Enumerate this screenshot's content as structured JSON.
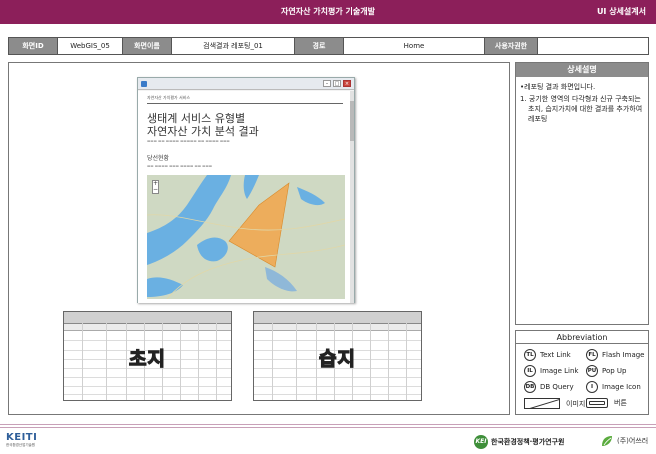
{
  "header": {
    "title": "자연자산 가치평가 기술개발",
    "doc_type": "UI 상세설계서"
  },
  "info": {
    "screen_id_label": "화면ID",
    "screen_id": "WebGIS_05",
    "screen_name_label": "화면이름",
    "screen_name": "검색결과 레포팅_01",
    "path_label": "경로",
    "path": "Home",
    "permission_label": "사용자권한",
    "permission": ""
  },
  "browser": {
    "site_name": "자연자산 가치평가 서비스",
    "heading_line1": "생태계 서비스 유형별",
    "heading_line2": "자연자산 가치 분석 결과",
    "section_title": "당선현황"
  },
  "tables": [
    {
      "overlay": "초지"
    },
    {
      "overlay": "습지"
    }
  ],
  "detail": {
    "header": "상세설명",
    "intro": "•레포팅 결과 화면입니다.",
    "items": [
      "1. 궁기한 영역의 다각형과 신규 구축되는 초지, 습지가치에 대한 결과를 추가하여 레포팅"
    ]
  },
  "abbreviation": {
    "header": "Abbreviation",
    "entries": [
      {
        "code": "TL",
        "label": "Text Link"
      },
      {
        "code": "FL",
        "label": "Flash Image"
      },
      {
        "code": "IL",
        "label": "Image Link"
      },
      {
        "code": "PU",
        "label": "Pop Up"
      },
      {
        "code": "DB",
        "label": "DB Query"
      },
      {
        "code": "I",
        "label": "Image Icon"
      }
    ],
    "image_label": "이미지",
    "button_label": "버튼"
  },
  "footer": {
    "left_logo": "KEITI",
    "left_logo_sub": "한국환경산업기술원",
    "mid_logo_mark": "KEI",
    "mid_logo": "한국환경정책·평가연구원",
    "right_logo": "(주)어쓰러"
  },
  "colors": {
    "brand": "#8c1f5a",
    "label_gray": "#8c8c8c",
    "polygon": "#f2a54a",
    "water": "#5aa7e0"
  }
}
